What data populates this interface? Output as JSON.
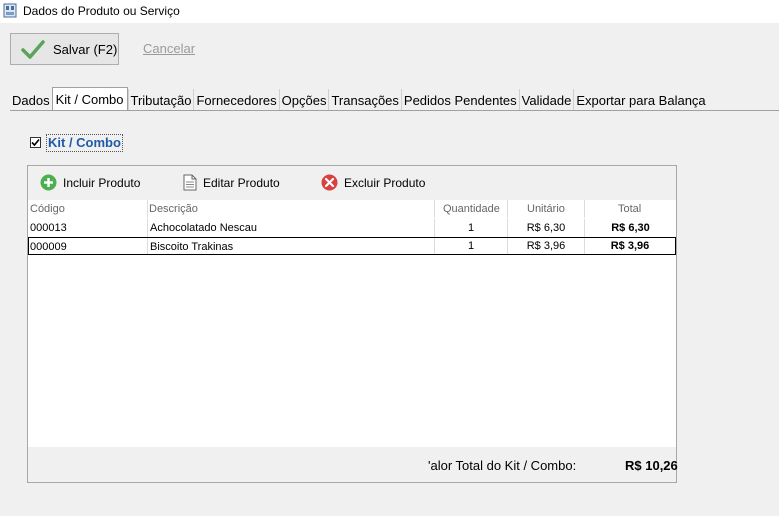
{
  "window": {
    "title": "Dados do Produto ou Serviço"
  },
  "toolbar": {
    "save_label": "Salvar (F2)",
    "cancel_label": "Cancelar"
  },
  "tabs": [
    {
      "label": "Dados"
    },
    {
      "label": "Kit / Combo",
      "active": true
    },
    {
      "label": "Tributação"
    },
    {
      "label": "Fornecedores"
    },
    {
      "label": "Opções"
    },
    {
      "label": "Transações"
    },
    {
      "label": "Pedidos Pendentes"
    },
    {
      "label": "Validade"
    },
    {
      "label": "Exportar para Balança"
    }
  ],
  "kit": {
    "label": "Kit / Combo",
    "checked": true
  },
  "panel_toolbar": {
    "include": "Incluir Produto",
    "edit": "Editar Produto",
    "delete": "Excluir Produto"
  },
  "table": {
    "headers": {
      "code": "Código",
      "desc": "Descrição",
      "qty": "Quantidade",
      "unit": "Unitário",
      "total": "Total"
    },
    "rows": [
      {
        "code": "000013",
        "desc": "Achocolatado Nescau",
        "qty": "1",
        "unit": "R$ 6,30",
        "total": "R$ 6,30"
      },
      {
        "code": "000009",
        "desc": "Biscoito Trakinas",
        "qty": "1",
        "unit": "R$ 3,96",
        "total": "R$ 3,96"
      }
    ]
  },
  "footer": {
    "label": "'alor Total do Kit / Combo:",
    "value": "R$ 10,26"
  },
  "colors": {
    "accent_green": "#4caf50",
    "link_blue": "#1f5aa8",
    "delete_red": "#d94141"
  }
}
